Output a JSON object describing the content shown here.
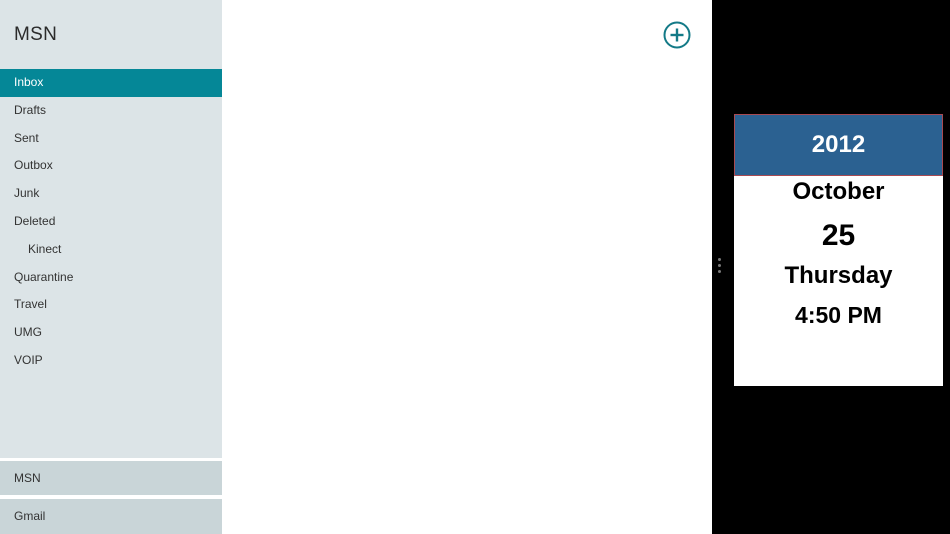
{
  "sidebar": {
    "account_title": "MSN",
    "folders": [
      {
        "label": "Inbox"
      },
      {
        "label": "Drafts"
      },
      {
        "label": "Sent"
      },
      {
        "label": "Outbox"
      },
      {
        "label": "Junk"
      },
      {
        "label": "Deleted"
      },
      {
        "label": "Kinect"
      },
      {
        "label": "Quarantine"
      },
      {
        "label": "Travel"
      },
      {
        "label": "UMG"
      },
      {
        "label": "VOIP"
      }
    ],
    "accounts": [
      {
        "label": "MSN"
      },
      {
        "label": "Gmail"
      }
    ]
  },
  "main": {
    "new_icon": "plus-circle-icon"
  },
  "snap": {
    "calendar": {
      "year": "2012",
      "month": "October",
      "day": "25",
      "weekday": "Thursday",
      "time": "4:50 PM"
    }
  },
  "colors": {
    "accent": "#058797",
    "sidebar_bg": "#dce4e7",
    "account_bg": "#c9d5d8",
    "calendar_header": "#2b6191"
  }
}
